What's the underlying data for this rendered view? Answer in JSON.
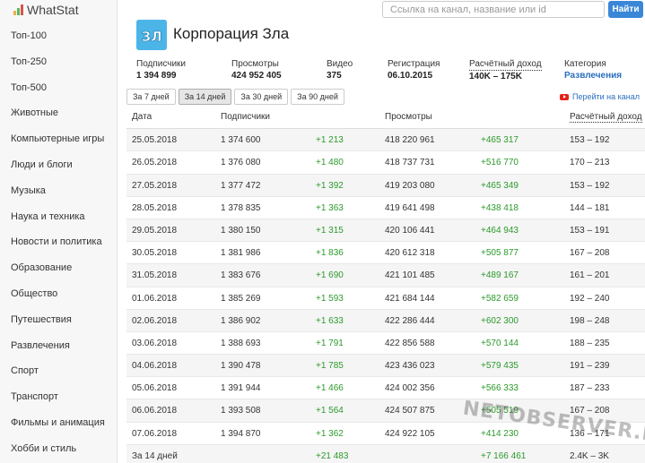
{
  "app": {
    "name": "WhatStat",
    "brand_colors": [
      "#f0ad4e",
      "#5cb85c",
      "#d9534f",
      "#3a87d8"
    ]
  },
  "search": {
    "placeholder": "Ссылка на канал, название или id",
    "button_label": "Найти"
  },
  "sidebar": {
    "items": [
      {
        "label": "Топ-100"
      },
      {
        "label": "Топ-250"
      },
      {
        "label": "Топ-500"
      },
      {
        "label": "Животные"
      },
      {
        "label": "Компьютерные игры"
      },
      {
        "label": "Люди и блоги"
      },
      {
        "label": "Музыка"
      },
      {
        "label": "Наука и техника"
      },
      {
        "label": "Новости и политика"
      },
      {
        "label": "Образование"
      },
      {
        "label": "Общество"
      },
      {
        "label": "Путешествия"
      },
      {
        "label": "Развлечения"
      },
      {
        "label": "Спорт"
      },
      {
        "label": "Транспорт"
      },
      {
        "label": "Фильмы и анимация"
      },
      {
        "label": "Хобби и стиль"
      }
    ]
  },
  "channel": {
    "title": "Корпорация Зла",
    "stats": {
      "subscribers": {
        "label": "Подписчики",
        "value": "1 394 899"
      },
      "views": {
        "label": "Просмотры",
        "value": "424 952 405"
      },
      "videos": {
        "label": "Видео",
        "value": "375"
      },
      "registered": {
        "label": "Регистрация",
        "value": "06.10.2015"
      },
      "income": {
        "label": "Расчётный доход",
        "value": "140K – 175K"
      },
      "category": {
        "label": "Категория",
        "value": "Развлечения"
      }
    }
  },
  "periods": {
    "buttons": [
      "За 7 дней",
      "За 14 дней",
      "За 30 дней",
      "За 90 дней"
    ],
    "selected": "За 14 дней"
  },
  "youtube_link": "Перейти на канал",
  "table": {
    "headers": {
      "date": "Дата",
      "subscribers": "Подписчики",
      "views": "Просмотры",
      "income": "Расчётный доход"
    },
    "rows": [
      {
        "date": "25.05.2018",
        "subs": "1 374 600",
        "dsubs": "+1 213",
        "views": "418 220 961",
        "dviews": "+465 317",
        "income": "153 – 192"
      },
      {
        "date": "26.05.2018",
        "subs": "1 376 080",
        "dsubs": "+1 480",
        "views": "418 737 731",
        "dviews": "+516 770",
        "income": "170 – 213"
      },
      {
        "date": "27.05.2018",
        "subs": "1 377 472",
        "dsubs": "+1 392",
        "views": "419 203 080",
        "dviews": "+465 349",
        "income": "153 – 192"
      },
      {
        "date": "28.05.2018",
        "subs": "1 378 835",
        "dsubs": "+1 363",
        "views": "419 641 498",
        "dviews": "+438 418",
        "income": "144 – 181"
      },
      {
        "date": "29.05.2018",
        "subs": "1 380 150",
        "dsubs": "+1 315",
        "views": "420 106 441",
        "dviews": "+464 943",
        "income": "153 – 191"
      },
      {
        "date": "30.05.2018",
        "subs": "1 381 986",
        "dsubs": "+1 836",
        "views": "420 612 318",
        "dviews": "+505 877",
        "income": "167 – 208"
      },
      {
        "date": "31.05.2018",
        "subs": "1 383 676",
        "dsubs": "+1 690",
        "views": "421 101 485",
        "dviews": "+489 167",
        "income": "161 – 201"
      },
      {
        "date": "01.06.2018",
        "subs": "1 385 269",
        "dsubs": "+1 593",
        "views": "421 684 144",
        "dviews": "+582 659",
        "income": "192 – 240"
      },
      {
        "date": "02.06.2018",
        "subs": "1 386 902",
        "dsubs": "+1 633",
        "views": "422 286 444",
        "dviews": "+602 300",
        "income": "198 – 248"
      },
      {
        "date": "03.06.2018",
        "subs": "1 388 693",
        "dsubs": "+1 791",
        "views": "422 856 588",
        "dviews": "+570 144",
        "income": "188 – 235"
      },
      {
        "date": "04.06.2018",
        "subs": "1 390 478",
        "dsubs": "+1 785",
        "views": "423 436 023",
        "dviews": "+579 435",
        "income": "191 – 239"
      },
      {
        "date": "05.06.2018",
        "subs": "1 391 944",
        "dsubs": "+1 466",
        "views": "424 002 356",
        "dviews": "+566 333",
        "income": "187 – 233"
      },
      {
        "date": "06.06.2018",
        "subs": "1 393 508",
        "dsubs": "+1 564",
        "views": "424 507 875",
        "dviews": "+505 519",
        "income": "167 – 208"
      },
      {
        "date": "07.06.2018",
        "subs": "1 394 870",
        "dsubs": "+1 362",
        "views": "424 922 105",
        "dviews": "+414 230",
        "income": "136 – 171"
      },
      {
        "date": "За 14 дней",
        "subs": "",
        "dsubs": "+21 483",
        "views": "",
        "dviews": "+7 166 461",
        "income": "2.4K – 3K"
      }
    ]
  },
  "watermark": "NETOBSERVER.RU"
}
